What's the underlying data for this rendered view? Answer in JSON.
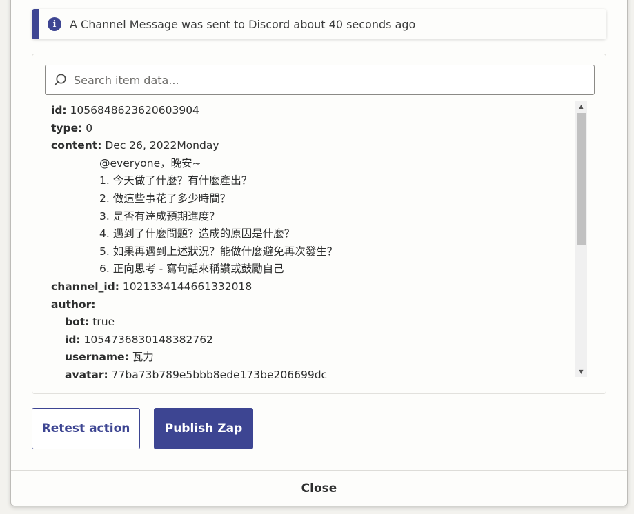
{
  "alert": {
    "icon": "info-icon",
    "text": "A Channel Message was sent to Discord about 40 seconds ago"
  },
  "search": {
    "placeholder": "Search item data...",
    "value": ""
  },
  "item": {
    "id_key": "id:",
    "id_value": "1056848623620603904",
    "type_key": "type:",
    "type_value": "0",
    "content_key": "content:",
    "content_lines": [
      "Dec 26, 2022Monday",
      "@everyone，晚安~",
      "1. 今天做了什麼？有什麼產出？",
      "2. 做這些事花了多少時間？",
      "3. 是否有達成預期進度？",
      "4. 遇到了什麼問題？造成的原因是什麼？",
      "5. 如果再遇到上述狀況？能做什麼避免再次發生？",
      "6. 正向思考 - 寫句話來稱讚或鼓勵自己"
    ],
    "channel_id_key": "channel_id:",
    "channel_id_value": "1021334144661332018",
    "author_key": "author:",
    "author": {
      "bot_key": "bot:",
      "bot_value": "true",
      "id_key": "id:",
      "id_value": "1054736830148382762",
      "username_key": "username:",
      "username_value": "瓦力",
      "avatar_key": "avatar:",
      "avatar_value": "77ba73b789e5bbb8ede173be206699dc"
    }
  },
  "buttons": {
    "retest": "Retest action",
    "publish": "Publish Zap",
    "close": "Close"
  },
  "colors": {
    "accent": "#3d4592",
    "background": "#fdfdfb"
  }
}
